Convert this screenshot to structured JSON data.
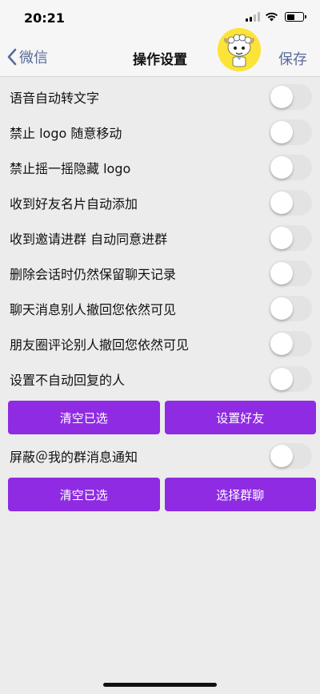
{
  "status_bar": {
    "time": "20:21",
    "icons": [
      "signal-icon",
      "wifi-icon",
      "battery-icon"
    ]
  },
  "nav": {
    "back_label": "微信",
    "title": "操作设置",
    "save_label": "保存",
    "avatar": "cartoon-sheep-avatar"
  },
  "colors": {
    "accent_purple": "#8f2be3",
    "nav_link": "#5a6b9a",
    "background": "#ececec"
  },
  "settings": [
    {
      "label": "语音自动转文字",
      "enabled": false
    },
    {
      "label": "禁止 logo 随意移动",
      "enabled": false
    },
    {
      "label": "禁止摇一摇隐藏 logo",
      "enabled": false
    },
    {
      "label": "收到好友名片自动添加",
      "enabled": false
    },
    {
      "label": "收到邀请进群 自动同意进群",
      "enabled": false
    },
    {
      "label": "删除会话时仍然保留聊天记录",
      "enabled": false
    },
    {
      "label": "聊天消息别人撤回您依然可见",
      "enabled": false
    },
    {
      "label": "朋友圈评论别人撤回您依然可见",
      "enabled": false
    },
    {
      "label": "设置不自动回复的人",
      "enabled": false
    }
  ],
  "buttons_1": {
    "clear": "清空已选",
    "set_friends": "设置好友"
  },
  "group_setting": {
    "label": "屏蔽＠我的群消息通知",
    "enabled": false
  },
  "buttons_2": {
    "clear": "清空已选",
    "select_group": "选择群聊"
  }
}
